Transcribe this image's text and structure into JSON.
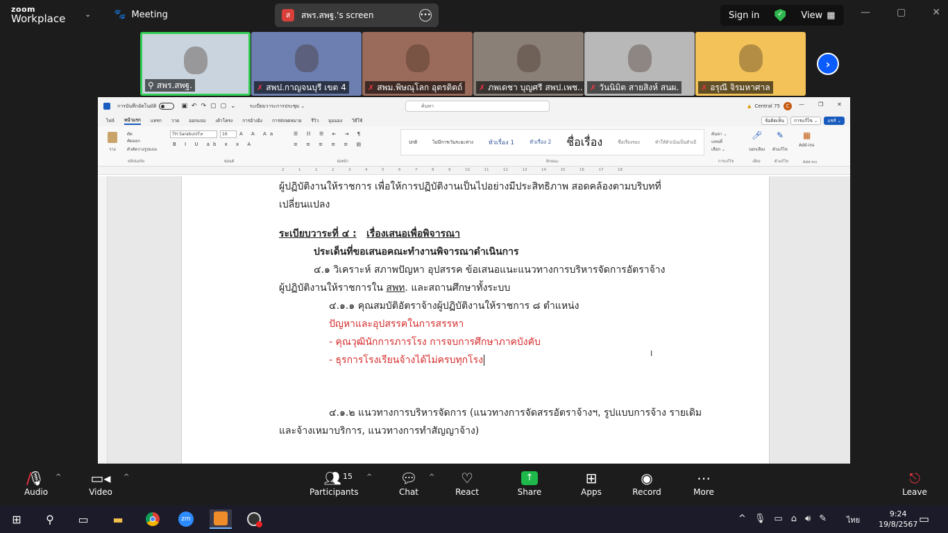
{
  "zoom": {
    "logo_line1": "zoom",
    "logo_line2": "Workplace",
    "meeting_label": "Meeting",
    "screen_share_label": "สพร.สพฐ.'s screen",
    "screen_badge": "ส",
    "sign_in": "Sign in",
    "view": "View",
    "participants": [
      {
        "name": "สพร.สพฐ.",
        "active": true,
        "muted": false,
        "bg": "#c9d4de"
      },
      {
        "name": "สพป.กาญจนบุรี เขต 4",
        "active": false,
        "muted": true,
        "bg": "#6d7fb0"
      },
      {
        "name": "สพม.พิษณุโลก อุตรดิตถ์",
        "active": false,
        "muted": true,
        "bg": "#9a6a5a"
      },
      {
        "name": "ภพเดชา บุญศรี สพป.เพช...",
        "active": false,
        "muted": true,
        "bg": "#8a8078"
      },
      {
        "name": "วันนิมิต สายสิงห์ สนผ.",
        "active": false,
        "muted": true,
        "bg": "#b8b8b8"
      },
      {
        "name": "อรุณี จิรมหาศาล",
        "active": false,
        "muted": true,
        "bg": "#f3c35a"
      }
    ],
    "toolbar": {
      "audio": "Audio",
      "video": "Video",
      "participants": "Participants",
      "participants_count": "15",
      "chat": "Chat",
      "react": "React",
      "share": "Share",
      "apps": "Apps",
      "record": "Record",
      "more": "More",
      "leave": "Leave"
    }
  },
  "word": {
    "autosave": "การบันทึกอัตโนมัติ",
    "doc_name": "ระเบียบวาระการประชุม ⌄",
    "search_placeholder": "ค้นหา",
    "user_name": "Central 75",
    "user_initial": "C",
    "tabs": [
      "ไฟล์",
      "หน้าแรก",
      "แทรก",
      "วาด",
      "ออกแบบ",
      "เค้าโครง",
      "การอ้างอิง",
      "การส่งจดหมาย",
      "รีวิว",
      "มุมมอง",
      "วิธีใช้"
    ],
    "selected_tab": "หน้าแรก",
    "tab_right": [
      "ข้อคิดเห็น",
      "การแก้ไข ⌄",
      "แชร์ ⌄"
    ],
    "font_name": "TH SarabunIT๙",
    "font_size": "16",
    "ribbon_groups": [
      "คลิปบอร์ด",
      "ฟอนต์",
      "ย่อหน้า",
      "ลักษณะ",
      "การแก้ไข",
      "เสียง",
      "ตัวแก้ไข",
      "Add-ins"
    ],
    "clipboard_labels": [
      "วาง",
      "ตัด",
      "คัดลอก",
      "ตัวคัดวางรูปแบบ"
    ],
    "editing_labels": [
      "ค้นหา ⌄",
      "แทนที่",
      "เลือก ⌄"
    ],
    "right_buttons": [
      "บอกเสียง",
      "ตัวแก้ไข",
      "Add-ins"
    ],
    "styles": [
      "ปกติ",
      "ไม่มีการเว้นระยะห่าง",
      "หัวเรื่อง 1",
      "หัวเรื่อง 2",
      "ชื่อเรื่อง",
      "ชื่อเรื่องรอง",
      "ทำให้ตัวเน้นเป็นตัวเอี"
    ],
    "ruler_numbers": [
      "2",
      "1",
      "1",
      "2",
      "3",
      "4",
      "5",
      "6",
      "7",
      "8",
      "9",
      "10",
      "11",
      "12",
      "13",
      "14",
      "15",
      "16",
      "17",
      "18"
    ],
    "doc_lines": [
      {
        "text": "ผู้ปฏิบัติงานให้ราชการ เพื่อให้การปฏิบัติงานเป็นไปอย่างมีประสิทธิภาพ สอดคล้องตามบริบทที่",
        "style": "normal"
      },
      {
        "text": "เปลี่ยนแปลง",
        "style": "normal"
      },
      {
        "text": "ระเบียบวาระที่ ๔ :",
        "style": "bold-ul"
      },
      {
        "text": "เรื่องเสนอเพื่อพิจารณา",
        "style": "bold-ul"
      },
      {
        "text": "ประเด็นที่ขอเสนอคณะทำงานพิจารณาดำเนินการ",
        "style": "bold"
      },
      {
        "text": "๔.๑ วิเคราะห์ สภาพปัญหา อุปสรรค ข้อเสนอแนะแนวทางการบริหารจัดการอัตราจ้าง",
        "style": "normal"
      },
      {
        "text": "ผู้ปฏิบัติงานให้ราชการใน",
        "style": "normal"
      },
      {
        "text": "สพท",
        "style": "ul"
      },
      {
        "text": ". และสถานศึกษาทั้งระบบ",
        "style": "normal"
      },
      {
        "text": "๔.๑.๑ คุณสมบัติอัตราจ้างผู้ปฏิบัติงานให้ราชการ ๘ ตำแหน่ง",
        "style": "normal"
      },
      {
        "text": "ปัญหาและอุปสรรคในการสรรหา",
        "style": "red"
      },
      {
        "text": "- คุณวุฒินักการภารโรง การจบการศึกษาภาคบังคับ",
        "style": "red"
      },
      {
        "text": "- ธุรการโรงเรียนจ้างได้ไม่ครบทุกโรง",
        "style": "red"
      },
      {
        "text": "๔.๑.๒ แนวทางการบริหารจัดการ (แนวทางการจัดสรรอัตราจ้างฯ, รูปแบบการจ้าง รายเดิม",
        "style": "normal"
      },
      {
        "text": "และจ้างเหมาบริการ, แนวทางการทำสัญญาจ้าง)",
        "style": "normal"
      }
    ]
  },
  "taskbar": {
    "language": "ไทย",
    "time": "9:24",
    "date": "19/8/2567"
  }
}
